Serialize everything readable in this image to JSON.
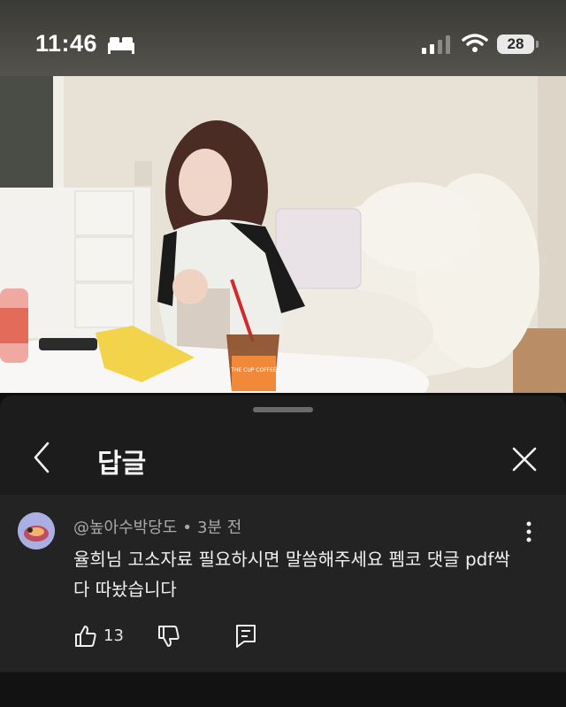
{
  "status_bar": {
    "time": "11:46",
    "battery": "28",
    "icons": [
      "bed-icon",
      "signal-icon",
      "wifi-icon",
      "battery-icon"
    ]
  },
  "video": {
    "cup_text": "THE CUP COFFEE"
  },
  "panel": {
    "title": "답글",
    "back_icon": "chevron-left-icon",
    "close_icon": "close-icon"
  },
  "comment": {
    "author": "@높아수박당도",
    "separator": "•",
    "time": "3분 전",
    "text": "율희님 고소자료 필요하시면 말씀해주세요 펨코 댓글 pdf싹다 따놨습니다",
    "likes": "13",
    "icons": [
      "thumbs-up-icon",
      "thumbs-down-icon",
      "reply-icon",
      "more-vertical-icon"
    ]
  },
  "colors": {
    "sheet_bg": "#1c1c1c",
    "comment_bg": "#232323",
    "text_primary": "#f1f1f1",
    "text_secondary": "#aaaaaa"
  }
}
